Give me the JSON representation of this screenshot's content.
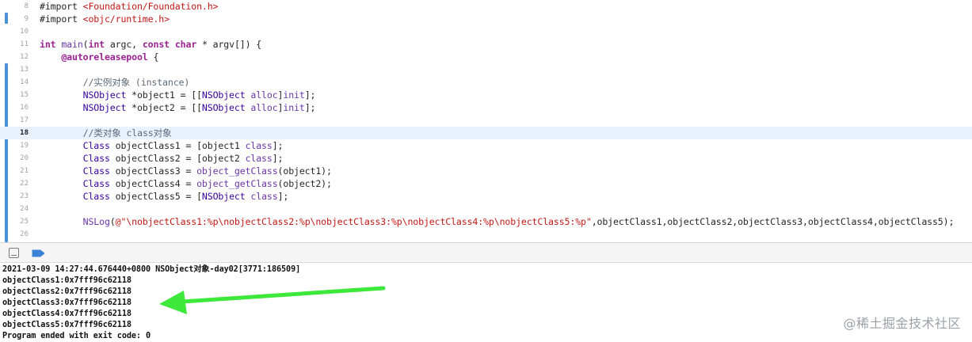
{
  "editor": {
    "current_line": 18,
    "lines": [
      {
        "num": "8",
        "tokens": [
          {
            "t": "plain",
            "s": "#import "
          },
          {
            "t": "str",
            "s": "<Foundation/Foundation.h>"
          }
        ]
      },
      {
        "num": "9",
        "tokens": [
          {
            "t": "plain",
            "s": "#import "
          },
          {
            "t": "str",
            "s": "<objc/runtime.h>"
          }
        ]
      },
      {
        "num": "10",
        "tokens": []
      },
      {
        "num": "11",
        "tokens": [
          {
            "t": "kw",
            "s": "int"
          },
          {
            "t": "plain",
            "s": " "
          },
          {
            "t": "fn",
            "s": "main"
          },
          {
            "t": "plain",
            "s": "("
          },
          {
            "t": "kw",
            "s": "int"
          },
          {
            "t": "plain",
            "s": " argc, "
          },
          {
            "t": "kw",
            "s": "const"
          },
          {
            "t": "plain",
            "s": " "
          },
          {
            "t": "kw",
            "s": "char"
          },
          {
            "t": "plain",
            "s": " * argv[]) {"
          }
        ]
      },
      {
        "num": "12",
        "tokens": [
          {
            "t": "plain",
            "s": "    "
          },
          {
            "t": "kw",
            "s": "@autoreleasepool"
          },
          {
            "t": "plain",
            "s": " {"
          }
        ]
      },
      {
        "num": "13",
        "tokens": []
      },
      {
        "num": "14",
        "tokens": [
          {
            "t": "plain",
            "s": "        "
          },
          {
            "t": "cmt",
            "s": "//实例对象 (instance)"
          }
        ]
      },
      {
        "num": "15",
        "tokens": [
          {
            "t": "plain",
            "s": "        "
          },
          {
            "t": "cls",
            "s": "NSObject"
          },
          {
            "t": "plain",
            "s": " *object1 = [["
          },
          {
            "t": "cls",
            "s": "NSObject"
          },
          {
            "t": "plain",
            "s": " "
          },
          {
            "t": "fn",
            "s": "alloc"
          },
          {
            "t": "plain",
            "s": "]"
          },
          {
            "t": "fn",
            "s": "init"
          },
          {
            "t": "plain",
            "s": "];"
          }
        ]
      },
      {
        "num": "16",
        "tokens": [
          {
            "t": "plain",
            "s": "        "
          },
          {
            "t": "cls",
            "s": "NSObject"
          },
          {
            "t": "plain",
            "s": " *object2 = [["
          },
          {
            "t": "cls",
            "s": "NSObject"
          },
          {
            "t": "plain",
            "s": " "
          },
          {
            "t": "fn",
            "s": "alloc"
          },
          {
            "t": "plain",
            "s": "]"
          },
          {
            "t": "fn",
            "s": "init"
          },
          {
            "t": "plain",
            "s": "];"
          }
        ]
      },
      {
        "num": "17",
        "tokens": []
      },
      {
        "num": "18",
        "tokens": [
          {
            "t": "plain",
            "s": "        "
          },
          {
            "t": "cmt",
            "s": "//类对象 class对象"
          }
        ]
      },
      {
        "num": "19",
        "tokens": [
          {
            "t": "plain",
            "s": "        "
          },
          {
            "t": "cls",
            "s": "Class"
          },
          {
            "t": "plain",
            "s": " objectClass1 = [object1 "
          },
          {
            "t": "fn",
            "s": "class"
          },
          {
            "t": "plain",
            "s": "];"
          }
        ]
      },
      {
        "num": "20",
        "tokens": [
          {
            "t": "plain",
            "s": "        "
          },
          {
            "t": "cls",
            "s": "Class"
          },
          {
            "t": "plain",
            "s": " objectClass2 = [object2 "
          },
          {
            "t": "fn",
            "s": "class"
          },
          {
            "t": "plain",
            "s": "];"
          }
        ]
      },
      {
        "num": "21",
        "tokens": [
          {
            "t": "plain",
            "s": "        "
          },
          {
            "t": "cls",
            "s": "Class"
          },
          {
            "t": "plain",
            "s": " objectClass3 = "
          },
          {
            "t": "fn",
            "s": "object_getClass"
          },
          {
            "t": "plain",
            "s": "(object1);"
          }
        ]
      },
      {
        "num": "22",
        "tokens": [
          {
            "t": "plain",
            "s": "        "
          },
          {
            "t": "cls",
            "s": "Class"
          },
          {
            "t": "plain",
            "s": " objectClass4 = "
          },
          {
            "t": "fn",
            "s": "object_getClass"
          },
          {
            "t": "plain",
            "s": "(object2);"
          }
        ]
      },
      {
        "num": "23",
        "tokens": [
          {
            "t": "plain",
            "s": "        "
          },
          {
            "t": "cls",
            "s": "Class"
          },
          {
            "t": "plain",
            "s": " objectClass5 = ["
          },
          {
            "t": "cls",
            "s": "NSObject"
          },
          {
            "t": "plain",
            "s": " "
          },
          {
            "t": "fn",
            "s": "class"
          },
          {
            "t": "plain",
            "s": "];"
          }
        ]
      },
      {
        "num": "24",
        "tokens": []
      },
      {
        "num": "25",
        "tokens": [
          {
            "t": "plain",
            "s": "        "
          },
          {
            "t": "fn",
            "s": "NSLog"
          },
          {
            "t": "plain",
            "s": "("
          },
          {
            "t": "str",
            "s": "@\"\\nobjectClass1:%p\\nobjectClass2:%p\\nobjectClass3:%p\\nobjectClass4:%p\\nobjectClass5:%p\""
          },
          {
            "t": "plain",
            "s": ",objectClass1,objectClass2,objectClass3,objectClass4,objectClass5);"
          }
        ]
      },
      {
        "num": "26",
        "tokens": []
      }
    ]
  },
  "debug_bar": {
    "hide_icon": "hide-debug-area-icon",
    "console_icon": "console-toggle-icon",
    "accent": "#3b82d6"
  },
  "console": {
    "lines": [
      "2021-03-09 14:27:44.676440+0800 NSObject对象-day02[3771:186509]",
      "objectClass1:0x7fff96c62118",
      "objectClass2:0x7fff96c62118",
      "objectClass3:0x7fff96c62118",
      "objectClass4:0x7fff96c62118",
      "objectClass5:0x7fff96c62118",
      "Program ended with exit code: 0"
    ]
  },
  "annotation": {
    "arrow_color": "#3ee83a",
    "icon": "green-arrow-icon"
  },
  "watermark": "@稀土掘金技术社区"
}
